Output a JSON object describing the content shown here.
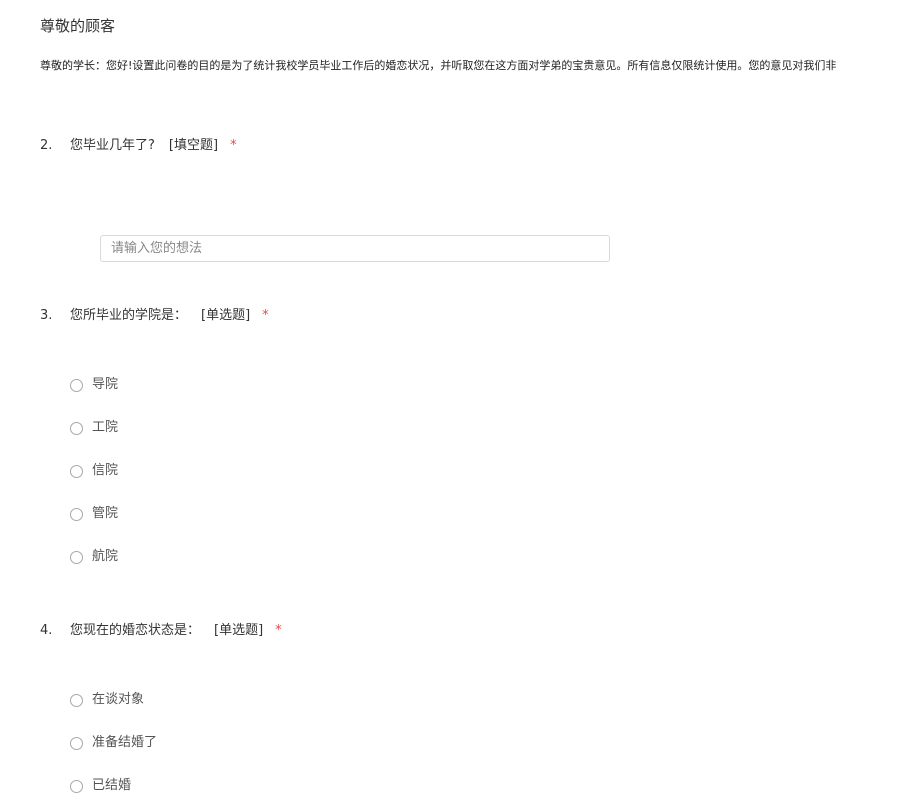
{
  "header": {
    "title": "尊敬的顾客",
    "intro": "尊敬的学长：您好!设置此问卷的目的是为了统计我校学员毕业工作后的婚恋状况，并听取您在这方面对学弟的宝贵意见。所有信息仅限统计使用。您的意见对我们非"
  },
  "questions": [
    {
      "number": "2.",
      "title": "您毕业几年了?",
      "type": "[填空题]",
      "required": "*",
      "input": {
        "placeholder": "请输入您的想法",
        "value": ""
      }
    },
    {
      "number": "3.",
      "title": "您所毕业的学院是：",
      "type": "[单选题]",
      "required": "*",
      "options": [
        "导院",
        "工院",
        "信院",
        "管院",
        "航院"
      ]
    },
    {
      "number": "4.",
      "title": "您现在的婚恋状态是：",
      "type": "[单选题]",
      "required": "*",
      "options": [
        "在谈对象",
        "准备结婚了",
        "已结婚"
      ]
    }
  ]
}
